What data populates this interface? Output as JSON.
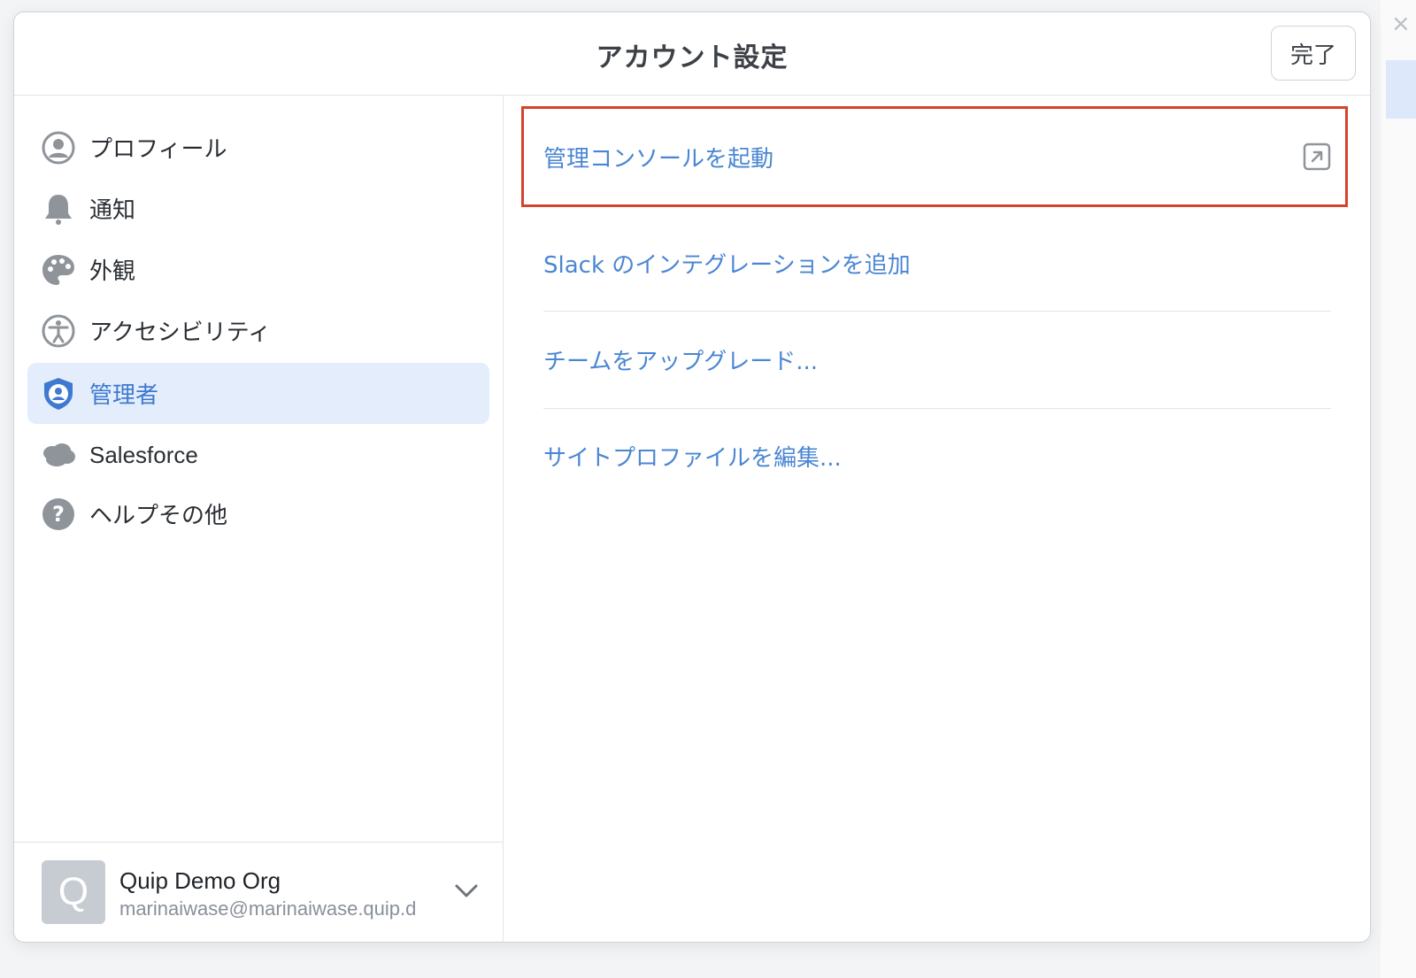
{
  "dialog": {
    "title": "アカウント設定",
    "done_label": "完了"
  },
  "sidebar": {
    "items": [
      {
        "label": "プロフィール",
        "icon": "profile-icon"
      },
      {
        "label": "通知",
        "icon": "bell-icon"
      },
      {
        "label": "外観",
        "icon": "palette-icon"
      },
      {
        "label": "アクセシビリティ",
        "icon": "accessibility-icon"
      },
      {
        "label": "管理者",
        "icon": "admin-shield-icon",
        "active": true
      },
      {
        "label": "Salesforce",
        "icon": "salesforce-cloud-icon"
      },
      {
        "label": "ヘルプその他",
        "icon": "help-icon"
      }
    ]
  },
  "account": {
    "avatar_letter": "Q",
    "name": "Quip Demo Org",
    "email": "marinaiwase@marinaiwase.quip.d"
  },
  "main": {
    "actions": [
      {
        "label": "管理コンソールを起動",
        "icon": "external-link-icon",
        "highlighted": true
      },
      {
        "label": "Slack のインテグレーションを追加"
      },
      {
        "label": "チームをアップグレード..."
      },
      {
        "label": "サイトプロファイルを編集..."
      }
    ]
  },
  "colors": {
    "accent": "#4a86d3",
    "active_bg": "#e3edfc",
    "highlight_border": "#d6432c",
    "icon_gray": "#8f949b"
  }
}
